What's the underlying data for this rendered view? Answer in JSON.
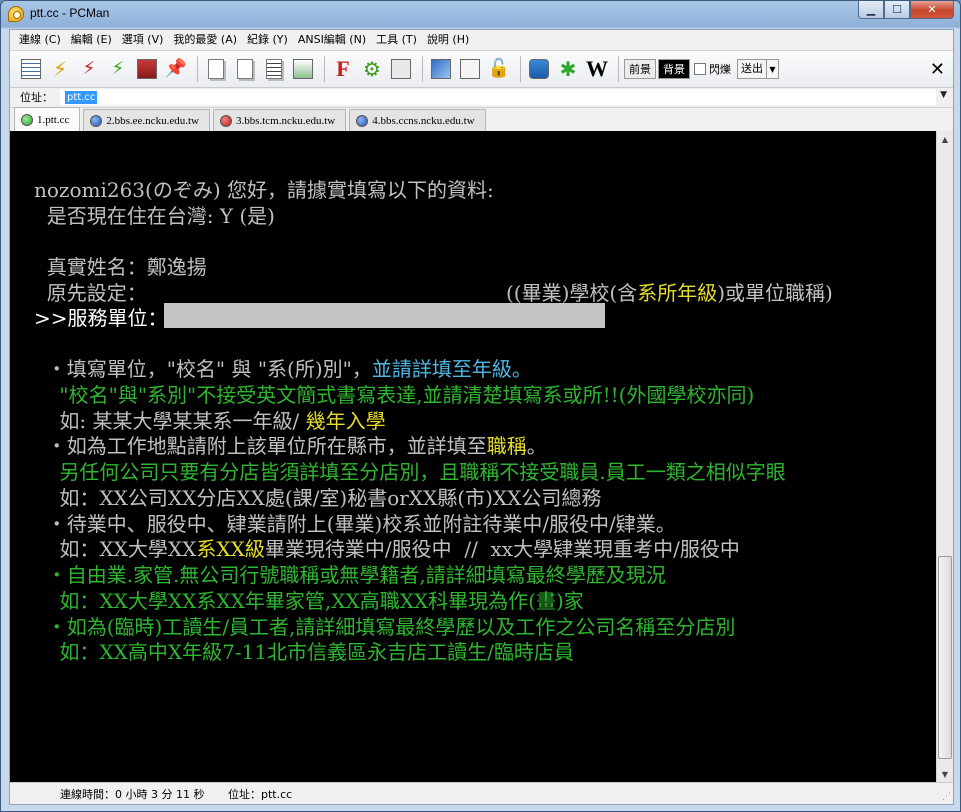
{
  "window": {
    "title": "ptt.cc - PCMan"
  },
  "menu": [
    "連線 (C)",
    "編輯 (E)",
    "選項 (V)",
    "我的最愛 (A)",
    "紀錄 (Y)",
    "ANSI編輯 (N)",
    "工具 (T)",
    "說明 (H)"
  ],
  "toolbar": {
    "icons": [
      "site-list-icon",
      "quick-connect-icon",
      "disconnect-icon",
      "reconnect-icon",
      "close-connection-icon",
      "add-favorite-icon",
      "copy-icon",
      "paste-icon",
      "copy-with-color-icon",
      "screenshot-icon",
      "font-icon",
      "settings-icon",
      "fullscreen-icon",
      "ansi-editor-icon",
      "custom-action-icon",
      "lock-icon",
      "ie-icon",
      "plugin-icon",
      "wikipedia-icon"
    ],
    "fg_label": "前景",
    "bg_label": "背景",
    "blink_label": "閃爍",
    "send_label": "送出",
    "close_glyph": "✕"
  },
  "address": {
    "label": "位址：",
    "value": "ptt.cc"
  },
  "tabs": [
    {
      "label": "1.ptt.cc",
      "color": "#2ea82e"
    },
    {
      "label": "2.bbs.ee.ncku.edu.tw",
      "color": "#2357b8"
    },
    {
      "label": "3.bbs.tcm.ncku.edu.tw",
      "color": "#c41a1a"
    },
    {
      "label": "4.bbs.ccns.ncku.edu.tw",
      "color": "#2357b8"
    }
  ],
  "terminal": {
    "greeting": "nozomi263(のぞみ) 您好，請據實填寫以下的資料:",
    "residence": "  是否現在住在台灣: Y (是)",
    "name_row": "  真實姓名：鄭逸揚",
    "original_row": "  原先設定：",
    "hint_a": "((畢業)學校(含",
    "hint_b": "系所年級",
    "hint_c": ")或單位職稱)",
    "prompt": ">>服務單位：",
    "l1a": "  ・填寫單位，\"校名\" 與 \"系(所)別\"，",
    "l1b": "並請詳填至年級。",
    "l2": "    \"校名\"與\"系別\"不接受英文簡式書寫表達,並請清楚填寫系或所!!(外國學校亦同)",
    "l3a": "    如: 某某大學某某系一年級/ ",
    "l3b": "幾年入學",
    "l4a": "  ・如為工作地點請附上該單位所在縣市，並詳填至",
    "l4b": "職稱",
    "l4c": "。",
    "l5": "    另任何公司只要有分店皆須詳填至分店別，且職稱不接受職員.員工一類之相似字眼",
    "l6": "    如：XX公司XX分店XX處(課/室)秘書orXX縣(市)XX公司總務",
    "l7": "  ・待業中、服役中、肄業請附上(畢業)校系並附註待業中/服役中/肄業。",
    "l8a": "    如：XX大學XX",
    "l8b": "系XX級",
    "l8c": "畢業現待業中/服役中  //  xx大學肄業現重考中/服役中",
    "l9": "  ・自由業.家管.無公司行號職稱或無學籍者,請詳細填寫最終學歷及現況",
    "l10": "    如：XX大學XX系XX年畢家管,XX高職XX科畢現為作(畫)家",
    "l11": "  ・如為(臨時)工讀生/員工者,請詳細填寫最終學歷以及工作之公司名稱至分店別",
    "l12": "    如：XX高中X年級7-11北市信義區永吉店工讀生/臨時店員"
  },
  "status": {
    "connected_time": "連線時間：0 小時 3 分 11 秒",
    "address": "位址：ptt.cc"
  }
}
